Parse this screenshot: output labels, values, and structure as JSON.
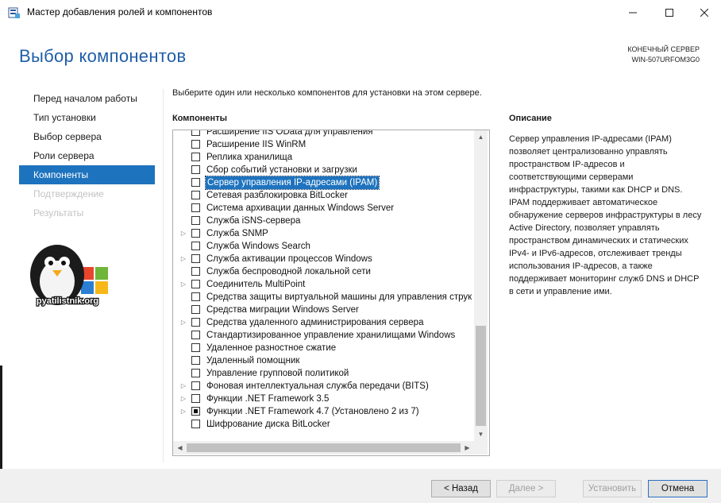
{
  "window": {
    "title": "Мастер добавления ролей и компонентов"
  },
  "header": {
    "page_title": "Выбор компонентов",
    "server_caption_line1": "КОНЕЧНЫЙ СЕРВЕР",
    "server_caption_line2": "WIN-507URFOM3G0"
  },
  "nav": {
    "items": [
      {
        "label": "Перед началом работы",
        "state": "normal"
      },
      {
        "label": "Тип установки",
        "state": "normal"
      },
      {
        "label": "Выбор сервера",
        "state": "normal"
      },
      {
        "label": "Роли сервера",
        "state": "normal"
      },
      {
        "label": "Компоненты",
        "state": "active"
      },
      {
        "label": "Подтверждение",
        "state": "disabled"
      },
      {
        "label": "Результаты",
        "state": "disabled"
      }
    ]
  },
  "logo": {
    "text": "pyatilistnik.org"
  },
  "main": {
    "instruction": "Выберите один или несколько компонентов для установки на этом сервере.",
    "components_header": "Компоненты",
    "description_header": "Описание",
    "components": [
      {
        "label": "Расширение IIS OData для управления",
        "expandable": false,
        "checked": "none"
      },
      {
        "label": "Расширение IIS WinRM",
        "expandable": false,
        "checked": "none"
      },
      {
        "label": "Реплика хранилища",
        "expandable": false,
        "checked": "none"
      },
      {
        "label": "Сбор событий установки и загрузки",
        "expandable": false,
        "checked": "none"
      },
      {
        "label": "Сервер управления IP-адресами (IPAM)",
        "expandable": false,
        "checked": "none",
        "selected": true
      },
      {
        "label": "Сетевая разблокировка BitLocker",
        "expandable": false,
        "checked": "none"
      },
      {
        "label": "Система архивации данных Windows Server",
        "expandable": false,
        "checked": "none"
      },
      {
        "label": "Служба iSNS-сервера",
        "expandable": false,
        "checked": "none"
      },
      {
        "label": "Служба SNMP",
        "expandable": true,
        "checked": "none"
      },
      {
        "label": "Служба Windows Search",
        "expandable": false,
        "checked": "none"
      },
      {
        "label": "Служба активации процессов Windows",
        "expandable": true,
        "checked": "none"
      },
      {
        "label": "Служба беспроводной локальной сети",
        "expandable": false,
        "checked": "none"
      },
      {
        "label": "Соединитель MultiPoint",
        "expandable": true,
        "checked": "none"
      },
      {
        "label": "Средства защиты виртуальной машины для управления струк",
        "expandable": false,
        "checked": "none"
      },
      {
        "label": "Средства миграции Windows Server",
        "expandable": false,
        "checked": "none"
      },
      {
        "label": "Средства удаленного администрирования сервера",
        "expandable": true,
        "checked": "none"
      },
      {
        "label": "Стандартизированное управление хранилищами Windows",
        "expandable": false,
        "checked": "none"
      },
      {
        "label": "Удаленное разностное сжатие",
        "expandable": false,
        "checked": "none"
      },
      {
        "label": "Удаленный помощник",
        "expandable": false,
        "checked": "none"
      },
      {
        "label": "Управление групповой политикой",
        "expandable": false,
        "checked": "none"
      },
      {
        "label": "Фоновая интеллектуальная служба передачи (BITS)",
        "expandable": true,
        "checked": "none"
      },
      {
        "label": "Функции .NET Framework 3.5",
        "expandable": true,
        "checked": "none"
      },
      {
        "label": "Функции .NET Framework 4.7 (Установлено 2 из 7)",
        "expandable": true,
        "checked": "partial"
      },
      {
        "label": "Шифрование диска BitLocker",
        "expandable": false,
        "checked": "none"
      }
    ],
    "description": "Сервер управления IP-адресами (IPAM) позволяет централизованно управлять пространством IP-адресов и соответствующими серверами инфраструктуры, такими как DHCP и DNS. IPAM поддерживает автоматическое обнаружение серверов инфраструктуры в лесу Active Directory, позволяет управлять пространством динамических и статических IPv4- и IPv6-адресов, отслеживает тренды использования IP-адресов, а также поддерживает мониторинг служб DNS и DHCP в сети и управление ими."
  },
  "footer": {
    "back_label": "< Назад",
    "next_label": "Далее >",
    "install_label": "Установить",
    "cancel_label": "Отмена"
  },
  "colors": {
    "accent": "#1e73be",
    "title": "#1f5ea8"
  }
}
